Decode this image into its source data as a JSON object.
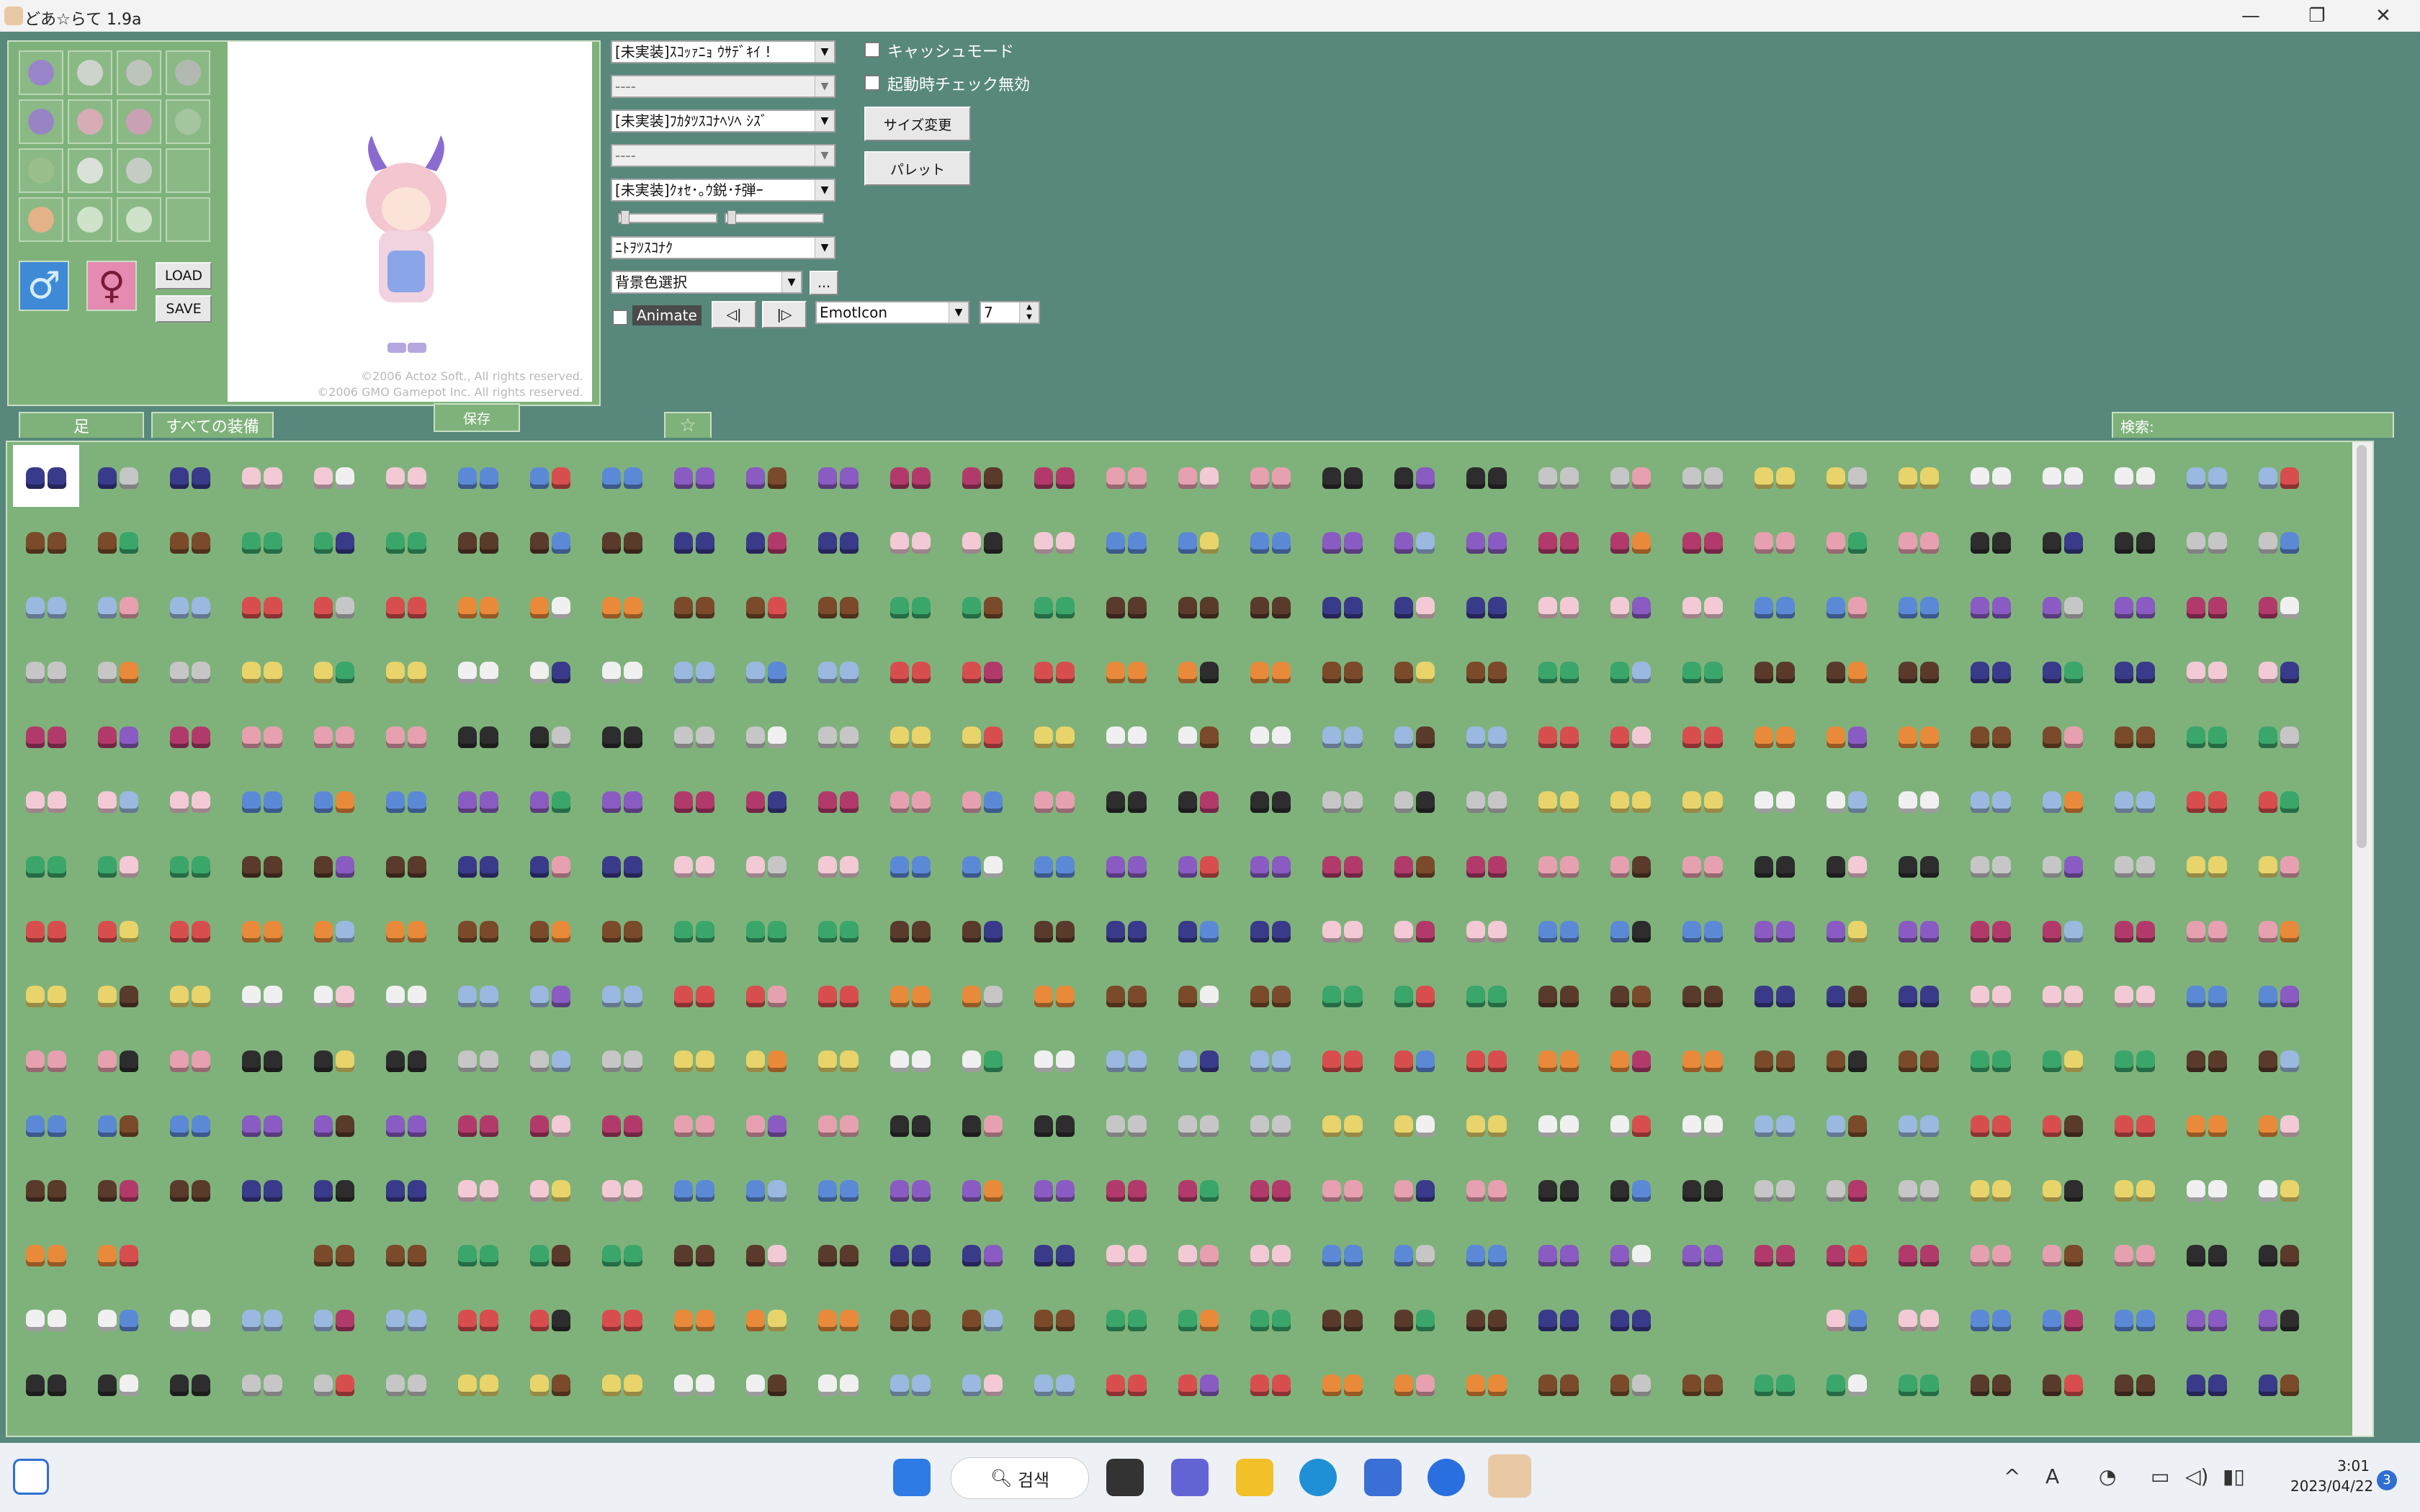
{
  "window": {
    "title": "どあ☆らて 1.9a",
    "controls": {
      "minimize": "—",
      "maximize": "❐",
      "close": "✕"
    }
  },
  "equip_icons": [
    {
      "name": "horn-headgear",
      "color": "#9b7cd6"
    },
    {
      "name": "glasses",
      "color": "#d8d8d8"
    },
    {
      "name": "robe",
      "color": "#c5c5c5"
    },
    {
      "name": "weapon",
      "color": "#b8b8b8"
    },
    {
      "name": "outfit-main",
      "color": "#9a7ad0"
    },
    {
      "name": "outfit-top",
      "color": "#e4a9c0"
    },
    {
      "name": "outfit-bottom",
      "color": "#d59cbc"
    },
    {
      "name": "shield",
      "color": "#a9c7a3"
    },
    {
      "name": "leaf",
      "color": "#9cc08e"
    },
    {
      "name": "accessory",
      "color": "#e8e8e8"
    },
    {
      "name": "boots",
      "color": "#cfcfcf"
    },
    {
      "name": "empty",
      "color": "#8bb986"
    },
    {
      "name": "face",
      "color": "#f2b08a"
    },
    {
      "name": "feather",
      "color": "#d9ead5"
    },
    {
      "name": "ring",
      "color": "#d9ead5"
    },
    {
      "name": "empty",
      "color": "#8bb986"
    }
  ],
  "buttons": {
    "load": "LOAD",
    "save": "SAVE",
    "male_symbol": "♂",
    "female_symbol": "♀",
    "size_change": "サイズ変更",
    "palette": "パレット",
    "browse": "...",
    "prev_frame": "◁|",
    "next_frame": "|▷"
  },
  "copyright": {
    "line1": "©2006 Actoz Soft., All rights reserved.",
    "line2": "©2006 GMO Gamepot Inc. All rights reserved."
  },
  "dropdowns": {
    "combo1": "[未実装]ｽｺｯｧﾆｮ ｳｻﾃﾞｷｲ !",
    "combo2": "----",
    "combo3": "[未実装]ﾌｶﾀﾂｽｺﾅﾍｿﾍ ｼｽﾞ",
    "combo4": "----",
    "combo5": "[未実装]ｸｫｾ･｡ｳ鋭･ﾁ弾ｰ",
    "combo6": "ﾆﾄｦﾂｽｺﾅｸ",
    "bg_color": "背景色選択",
    "emot": "EmotIcon",
    "frame_value": "7"
  },
  "checkboxes": {
    "cache_mode": "キャッシュモード",
    "startup_check": "起動時チェック無効",
    "animate": "Animate"
  },
  "tabs": {
    "foot": "足",
    "all_equip": "すべての装備",
    "keep": "保存",
    "favorite": "☆",
    "search": "検索:"
  },
  "taskbar": {
    "search_label": "검색",
    "time": "3:01",
    "date": "2023/04/22",
    "notification_count": "3",
    "ime": "A"
  },
  "item_palette": [
    "#3a3a8a",
    "#d84e4e",
    "#2d2d2d",
    "#f3c9d6",
    "#e98a3a",
    "#c6c6c6",
    "#5c89d6",
    "#7a4a2a",
    "#e8d46a",
    "#8a5bc2",
    "#3aa66a",
    "#f0f0f0",
    "#b23a6a",
    "#5a3a2a",
    "#9ab8e0",
    "#e7a0b0"
  ]
}
